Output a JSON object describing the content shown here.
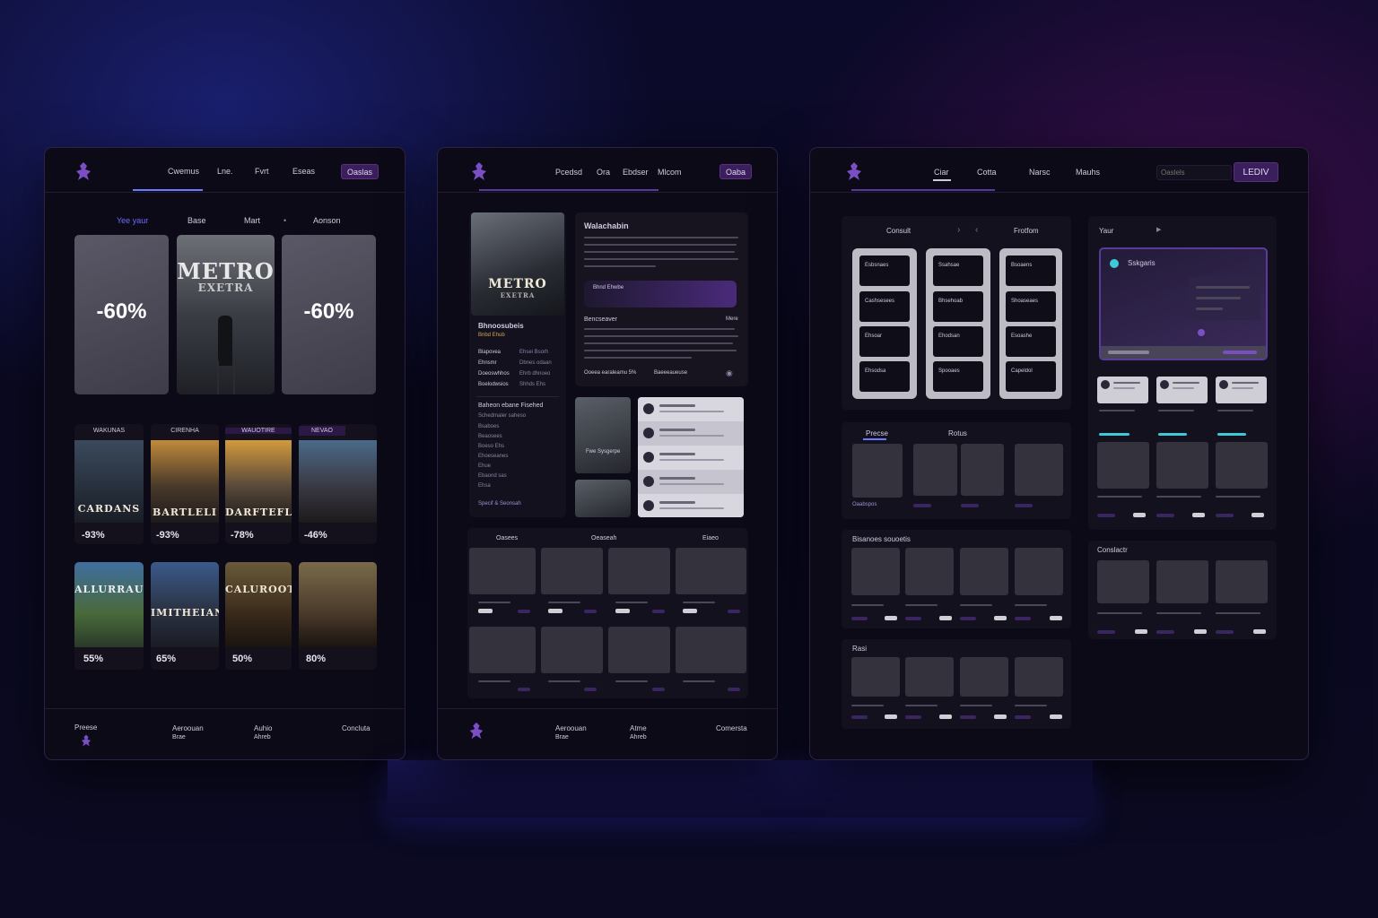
{
  "panel1": {
    "nav": [
      "Cwemus",
      "Lne.",
      "Fvrt",
      "Eseas"
    ],
    "cta": "Oaslas",
    "tabs": [
      "Yee yaur",
      "Base",
      "Mart",
      "Aonson"
    ],
    "hero": {
      "discount_left": "-60%",
      "discount_right": "-60%",
      "poster_title_1": "METRO",
      "poster_title_2": "EXETRA"
    },
    "row1": [
      {
        "badge": "WAKUNAS",
        "title": "CARDANS",
        "pct": "-93%"
      },
      {
        "badge": "CIRENHA",
        "title": "BARTLELI",
        "pct": "-93%"
      },
      {
        "badge": "WAUOTIRE",
        "title": "DARFTEFLI",
        "pct": "-78%"
      },
      {
        "badge": "NEVAO",
        "title": "",
        "pct": "-46%"
      }
    ],
    "row2": [
      {
        "title": "ALLURRAUS.",
        "pct": "55%"
      },
      {
        "title": "IMITHEIAN",
        "pct": "65%"
      },
      {
        "title": "CALUROOTY",
        "pct": "50%"
      },
      {
        "title": "",
        "pct": "80%"
      }
    ],
    "footer": {
      "c1": "Preese",
      "c2a": "Aeroouan",
      "c2b": "Brae",
      "c3a": "Auhio",
      "c3b": "Ahreb",
      "c4": "Concluta"
    }
  },
  "panel2": {
    "nav": [
      "Pcedsd",
      "Ora",
      "Ebdser",
      "Mlcom"
    ],
    "cta": "Oaba",
    "game": {
      "poster_title_1": "METRO",
      "poster_title_2": "EXETRA",
      "title": "Walachabin",
      "section1": "Bhnoosubeis",
      "section1_sub": "Bnbd Ehub",
      "details": [
        [
          "Blapovea",
          "Ehsei Bsorh"
        ],
        [
          "Ehnsmr",
          "Dbnes odaan"
        ],
        [
          "Doeoswhhos",
          "Ehrb dhnoeo"
        ],
        [
          "Boelodwsios",
          "Shhds Ehs"
        ]
      ],
      "section2": "Baheon ebane Fisehed",
      "section2_sub": "Schedmaler saheso",
      "spec_rows": [
        "Bsaboes",
        "Beaosees",
        "Boeso Ehs",
        "Ehoeseanes",
        "Ehue",
        "Ebaond sas",
        "Ehsa"
      ],
      "footer_link": "Specif & Seonsah",
      "highlight": "Bhnd Ehwbe",
      "reviews_title": "Bencseaver",
      "reviews_more": "Mere",
      "reviews_foot_a": "Ooeea earaleamu 5%",
      "reviews_foot_b": "Baeeeaueuse",
      "thumb_caption": "Fwe Sysgerpe"
    },
    "grid_tabs": [
      "Oasees",
      "Oeaseah",
      "Eiaeo"
    ],
    "footer": {
      "c2a": "Aeroouan",
      "c2b": "Brae",
      "c3a": "Atme",
      "c3b": "Ahreb",
      "c4": "Comersta"
    }
  },
  "panel3": {
    "nav": [
      "Ciar",
      "Cotta",
      "Narsc",
      "Mauhs"
    ],
    "search_placeholder": "Oaslels",
    "cta": "LEDIV",
    "board": {
      "left": "Consult",
      "right": "Frotfom"
    },
    "columns": [
      [
        "Esbsnaes",
        "Cashsesees",
        "Ehsoar",
        "Ehsodsa"
      ],
      [
        "Ssahsae",
        "Bhsehoab",
        "Ehodsan",
        "Spooaes"
      ],
      [
        "Bsoaens",
        "Shoaseaes",
        "Esoashe",
        "Capeldol"
      ]
    ],
    "section_a": {
      "tabs": [
        "Precse",
        "Rotus"
      ],
      "footer": "Oaabspos"
    },
    "section_b": "Bisanoes souoetis",
    "section_c": "Rasi",
    "side_title": "Yaur",
    "notif": "Sskgaris",
    "side_section": "Conslactr"
  },
  "colors": {
    "accent": "#6b3fb0",
    "accent_dark": "#3b1e5c",
    "panel_bg": "#0c0a17",
    "teal": "#3ec9d6"
  }
}
